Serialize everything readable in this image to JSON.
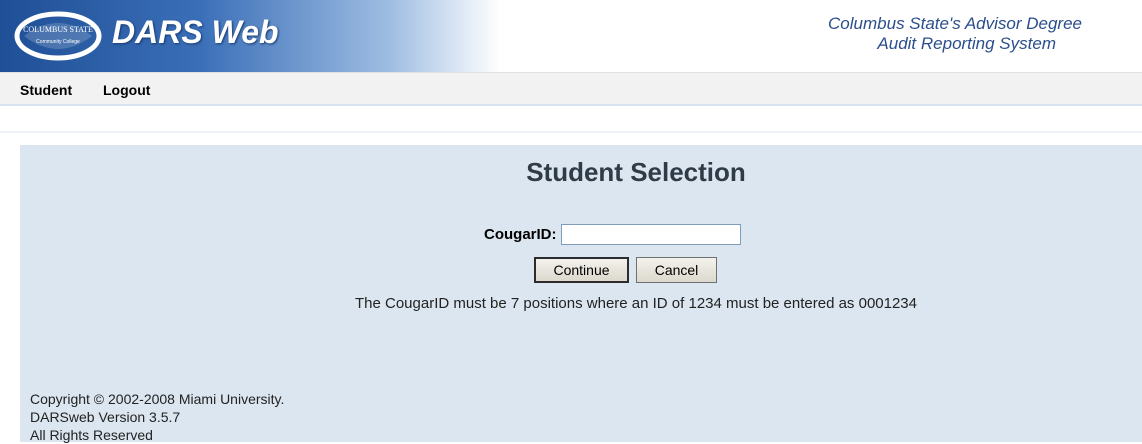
{
  "header": {
    "logo_top": "COLUMBUS STATE",
    "logo_bottom": "Community College",
    "app_title": "DARS Web",
    "subtitle_line1": "Columbus State's Advisor Degree",
    "subtitle_line2": "Audit Reporting System"
  },
  "nav": {
    "items": [
      {
        "label": "Student"
      },
      {
        "label": "Logout"
      }
    ]
  },
  "main": {
    "title": "Student Selection",
    "id_label": "CougarID:",
    "id_value": "",
    "continue_label": "Continue",
    "cancel_label": "Cancel",
    "hint": "The CougarID must be 7 positions where an ID of 1234 must be entered as 0001234"
  },
  "footer": {
    "copyright": "Copyright © 2002-2008 Miami University.",
    "version": "DARSweb Version 3.5.7",
    "rights": "All Rights Reserved"
  },
  "colors": {
    "banner_dark": "#1f4f96",
    "panel_bg": "#dce6f0",
    "subtitle_color": "#2b4f8c"
  }
}
